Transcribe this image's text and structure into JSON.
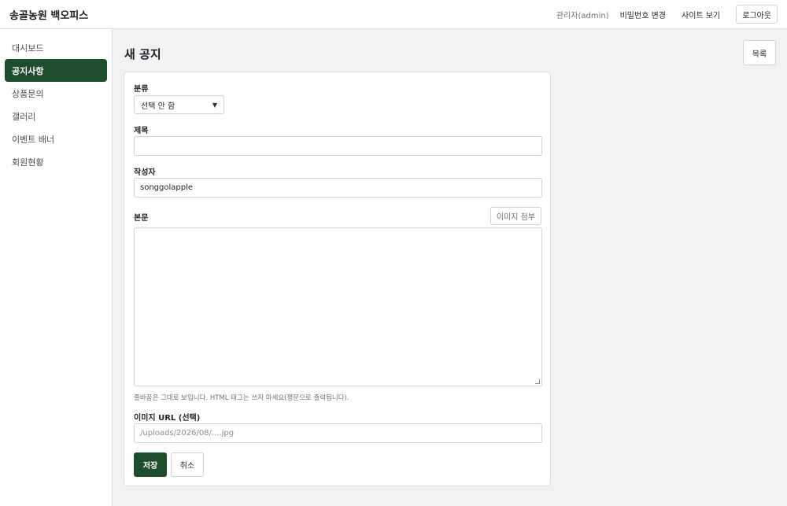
{
  "header": {
    "brand": "송골농원 백오피스",
    "admin_label": "관리자(admin)",
    "change_password": "비밀번호 변경",
    "view_site": "사이트 보기",
    "logout": "로그아웃"
  },
  "sidebar": {
    "items": [
      {
        "label": "대시보드",
        "active": false
      },
      {
        "label": "공지사항",
        "active": true
      },
      {
        "label": "상품문의",
        "active": false
      },
      {
        "label": "갤러리",
        "active": false
      },
      {
        "label": "이벤트 배너",
        "active": false
      },
      {
        "label": "회원현황",
        "active": false
      }
    ]
  },
  "main": {
    "title": "새 공지",
    "list_button": "목록"
  },
  "form": {
    "category_label": "분류",
    "category_value": "선택 안 함",
    "title_label": "제목",
    "title_value": "",
    "author_label": "작성자",
    "author_value": "songgolapple",
    "body_label": "본문",
    "attach_button": "이미지 첨부",
    "body_value": "",
    "hint": "줄바꿈은 그대로 보입니다. HTML 태그는 쓰지 마세요(평문으로 출력됩니다).",
    "image_url_label": "이미지 URL (선택)",
    "image_url_placeholder": "/uploads/2026/08/....jpg",
    "save_button": "저장",
    "cancel_button": "취소"
  },
  "colors": {
    "accent": "#1d4d2c",
    "background": "#f1f2f3"
  }
}
